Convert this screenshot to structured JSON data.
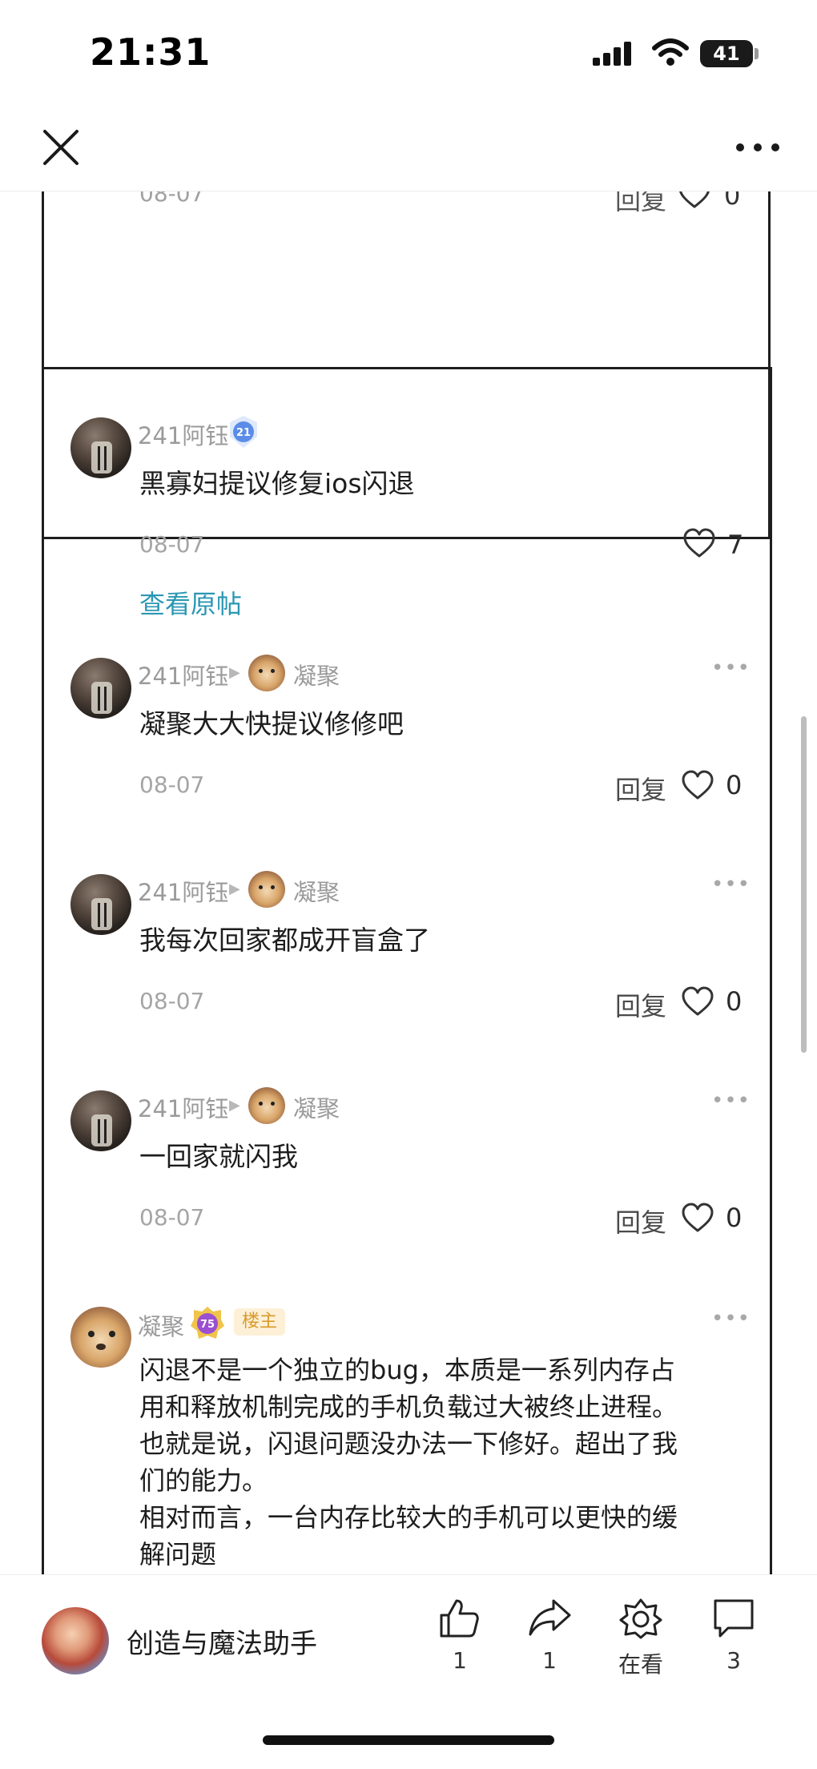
{
  "status_bar": {
    "time": "21:31",
    "battery": "41",
    "signal_icon": "cellular-signal-icon",
    "wifi_icon": "wifi-icon"
  },
  "nav": {
    "close_icon": "close-icon",
    "more_icon": "more-horizontal-icon"
  },
  "previous_comment": {
    "date": "08-07",
    "reply_label": "回复",
    "likes": "0"
  },
  "thread": {
    "main_comment": {
      "username": "241阿钰",
      "level": "21",
      "text": "黑寡妇提议修复ios闪退",
      "date": "08-07",
      "likes": "7",
      "view_original": "查看原帖"
    },
    "replies": [
      {
        "username": "241阿钰",
        "reply_to": "凝聚",
        "text": "凝聚大大快提议修修吧",
        "date": "08-07",
        "reply_label": "回复",
        "likes": "0"
      },
      {
        "username": "241阿钰",
        "reply_to": "凝聚",
        "text": "我每次回家都成开盲盒了",
        "date": "08-07",
        "reply_label": "回复",
        "likes": "0"
      },
      {
        "username": "241阿钰",
        "reply_to": "凝聚",
        "text": "一回家就闪我",
        "date": "08-07",
        "reply_label": "回复",
        "likes": "0"
      }
    ],
    "host_reply": {
      "username": "凝聚",
      "level": "75",
      "tag": "楼主",
      "text": "闪退不是一个独立的bug，本质是一系列内存占\n用和释放机制完成的手机负载过大被终止进程。\n也就是说，闪退问题没办法一下修好。超出了我\n们的能力。\n相对而言，一台内存比较大的手机可以更快的缓\n解问题"
    }
  },
  "bottom_bar": {
    "author_name": "创造与魔法助手",
    "actions": [
      {
        "icon": "thumbs-up-icon",
        "label": "1"
      },
      {
        "icon": "share-icon",
        "label": "1"
      },
      {
        "icon": "watching-icon",
        "label": "在看"
      },
      {
        "icon": "comment-icon",
        "label": "3"
      }
    ]
  },
  "colors": {
    "link": "#2b97b3",
    "host_tag_bg": "#fdf0d6",
    "host_tag_text": "#d99a2b",
    "level_blue": "#5b8de8",
    "level_purple": "#9b4fd1"
  }
}
